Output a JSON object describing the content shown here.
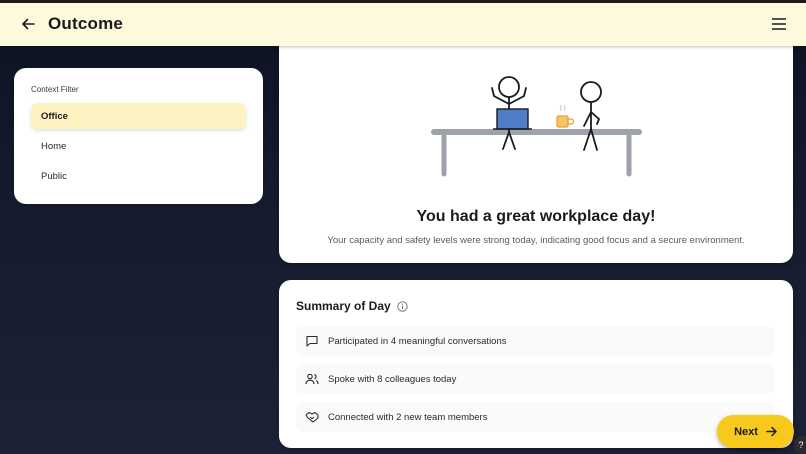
{
  "header": {
    "title": "Outcome",
    "back_icon": "arrow-left-icon",
    "menu_icon": "hamburger-menu-icon"
  },
  "filter": {
    "label": "Context Filter",
    "items": [
      {
        "label": "Office",
        "active": true
      },
      {
        "label": "Home",
        "active": false
      },
      {
        "label": "Public",
        "active": false
      }
    ]
  },
  "outcome": {
    "title": "You had a great workplace day!",
    "description": "Your capacity and safety levels were strong today, indicating good focus and a secure environment."
  },
  "summary": {
    "title": "Summary of Day",
    "items": [
      {
        "icon": "chat-bubble-icon",
        "text": "Participated in 4 meaningful conversations"
      },
      {
        "icon": "people-icon",
        "text": "Spoke with 8 colleagues today"
      },
      {
        "icon": "handshake-icon",
        "text": "Connected with 2 new team members"
      }
    ]
  },
  "actions": {
    "next_label": "Next",
    "help_label": "?"
  },
  "colors": {
    "header_bg": "#fdf9dd",
    "accent": "#f7c91c",
    "active_filter": "#fdf3c2",
    "page_bg": "#0d1222"
  }
}
